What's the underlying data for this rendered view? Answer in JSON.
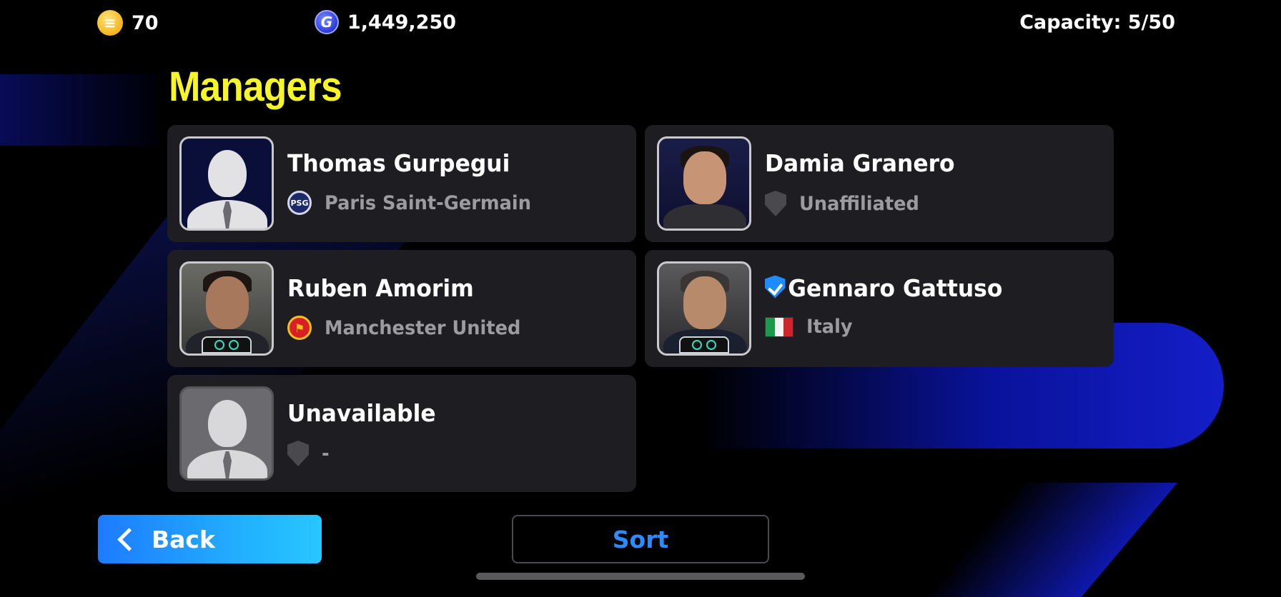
{
  "currency": {
    "coins": "70",
    "gp": "1,449,250",
    "coin_icon": "coin-icon",
    "gp_icon": "gp-icon",
    "gp_symbol": "G"
  },
  "capacity": "Capacity: 5/50",
  "title": "Managers",
  "managers": [
    {
      "name": "Thomas Gurpegui",
      "team": "Paris Saint-Germain",
      "team_icon": "psg-crest-icon"
    },
    {
      "name": "Damia Granero",
      "team": "Unaffiliated",
      "team_icon": "shield-icon"
    },
    {
      "name": "Ruben Amorim",
      "team": "Manchester United",
      "team_icon": "manchester-united-crest-icon"
    },
    {
      "name": "Gennaro Gattuso",
      "team": "Italy",
      "team_icon": "italy-flag-icon",
      "verified": true
    },
    {
      "name": "Unavailable",
      "team": "-",
      "team_icon": "shield-icon"
    }
  ],
  "buttons": {
    "back": "Back",
    "sort": "Sort"
  },
  "colors": {
    "title": "#f5f52a",
    "accent_blue": "#1e7bff",
    "sort_text": "#2a8cff",
    "card_bg": "#1e1e22"
  }
}
